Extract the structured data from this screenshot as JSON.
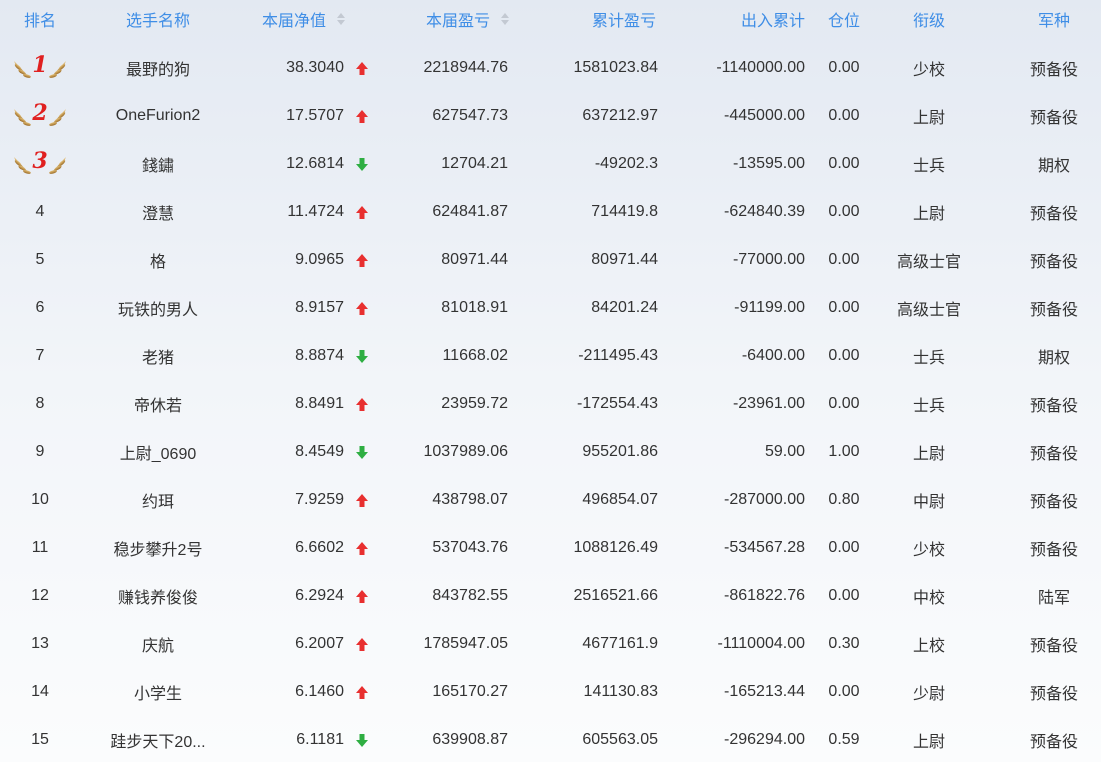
{
  "headers": {
    "rank": "排名",
    "name": "选手名称",
    "nav": "本届净值",
    "pnl": "本届盈亏",
    "cumulative": "累计盈亏",
    "flow": "出入累计",
    "position": "仓位",
    "title": "衔级",
    "branch": "军种"
  },
  "icons": {
    "sort": "sort-icon",
    "up": "arrow-up-icon",
    "down": "arrow-down-icon",
    "medal": "laurel-medal-icon"
  },
  "colors": {
    "header_text": "#3f8ee6",
    "up": "#e82f2f",
    "down": "#2eae42",
    "medal_number": "#e02020"
  },
  "rows": [
    {
      "rank": "1",
      "medal": true,
      "name": "最野的狗",
      "nav": "38.3040",
      "trend": "up",
      "pnl": "2218944.76",
      "cumulative": "1581023.84",
      "flow": "-1140000.00",
      "position": "0.00",
      "title": "少校",
      "branch": "预备役"
    },
    {
      "rank": "2",
      "medal": true,
      "name": "OneFurion2",
      "nav": "17.5707",
      "trend": "up",
      "pnl": "627547.73",
      "cumulative": "637212.97",
      "flow": "-445000.00",
      "position": "0.00",
      "title": "上尉",
      "branch": "预备役"
    },
    {
      "rank": "3",
      "medal": true,
      "name": "錢鏽",
      "nav": "12.6814",
      "trend": "down",
      "pnl": "12704.21",
      "cumulative": "-49202.3",
      "flow": "-13595.00",
      "position": "0.00",
      "title": "士兵",
      "branch": "期权"
    },
    {
      "rank": "4",
      "medal": false,
      "name": "澄慧",
      "nav": "11.4724",
      "trend": "up",
      "pnl": "624841.87",
      "cumulative": "714419.8",
      "flow": "-624840.39",
      "position": "0.00",
      "title": "上尉",
      "branch": "预备役"
    },
    {
      "rank": "5",
      "medal": false,
      "name": "格",
      "nav": "9.0965",
      "trend": "up",
      "pnl": "80971.44",
      "cumulative": "80971.44",
      "flow": "-77000.00",
      "position": "0.00",
      "title": "高级士官",
      "branch": "预备役"
    },
    {
      "rank": "6",
      "medal": false,
      "name": "玩铁的男人",
      "nav": "8.9157",
      "trend": "up",
      "pnl": "81018.91",
      "cumulative": "84201.24",
      "flow": "-91199.00",
      "position": "0.00",
      "title": "高级士官",
      "branch": "预备役"
    },
    {
      "rank": "7",
      "medal": false,
      "name": "老猪",
      "nav": "8.8874",
      "trend": "down",
      "pnl": "11668.02",
      "cumulative": "-211495.43",
      "flow": "-6400.00",
      "position": "0.00",
      "title": "士兵",
      "branch": "期权"
    },
    {
      "rank": "8",
      "medal": false,
      "name": "帝休若",
      "nav": "8.8491",
      "trend": "up",
      "pnl": "23959.72",
      "cumulative": "-172554.43",
      "flow": "-23961.00",
      "position": "0.00",
      "title": "士兵",
      "branch": "预备役"
    },
    {
      "rank": "9",
      "medal": false,
      "name": "上尉_0690",
      "nav": "8.4549",
      "trend": "down",
      "pnl": "1037989.06",
      "cumulative": "955201.86",
      "flow": "59.00",
      "position": "1.00",
      "title": "上尉",
      "branch": "预备役"
    },
    {
      "rank": "10",
      "medal": false,
      "name": "约珥",
      "nav": "7.9259",
      "trend": "up",
      "pnl": "438798.07",
      "cumulative": "496854.07",
      "flow": "-287000.00",
      "position": "0.80",
      "title": "中尉",
      "branch": "预备役"
    },
    {
      "rank": "11",
      "medal": false,
      "name": "稳步攀升2号",
      "nav": "6.6602",
      "trend": "up",
      "pnl": "537043.76",
      "cumulative": "1088126.49",
      "flow": "-534567.28",
      "position": "0.00",
      "title": "少校",
      "branch": "预备役"
    },
    {
      "rank": "12",
      "medal": false,
      "name": "赚钱养俊俊",
      "nav": "6.2924",
      "trend": "up",
      "pnl": "843782.55",
      "cumulative": "2516521.66",
      "flow": "-861822.76",
      "position": "0.00",
      "title": "中校",
      "branch": "陆军"
    },
    {
      "rank": "13",
      "medal": false,
      "name": "庆航",
      "nav": "6.2007",
      "trend": "up",
      "pnl": "1785947.05",
      "cumulative": "4677161.9",
      "flow": "-1110004.00",
      "position": "0.30",
      "title": "上校",
      "branch": "预备役"
    },
    {
      "rank": "14",
      "medal": false,
      "name": "小学生",
      "nav": "6.1460",
      "trend": "up",
      "pnl": "165170.27",
      "cumulative": "141130.83",
      "flow": "-165213.44",
      "position": "0.00",
      "title": "少尉",
      "branch": "预备役"
    },
    {
      "rank": "15",
      "medal": false,
      "name": "跬步天下20...",
      "nav": "6.1181",
      "trend": "down",
      "pnl": "639908.87",
      "cumulative": "605563.05",
      "flow": "-296294.00",
      "position": "0.59",
      "title": "上尉",
      "branch": "预备役"
    }
  ]
}
